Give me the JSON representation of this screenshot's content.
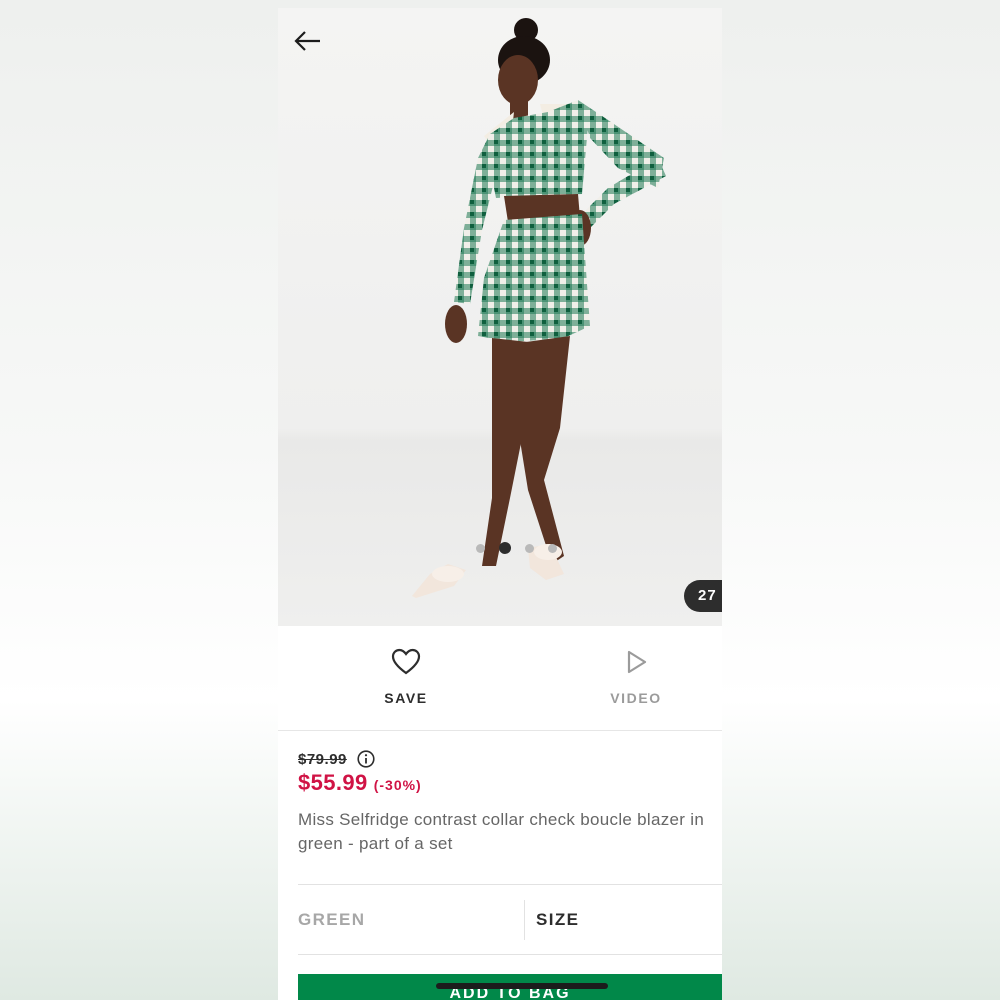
{
  "hero": {
    "image_count_badge": "27",
    "carousel": {
      "total": 4,
      "active_index": 1
    }
  },
  "actions": {
    "save_label": "SAVE",
    "video_label": "VIDEO"
  },
  "price": {
    "old": "$79.99",
    "now": "$55.99",
    "discount": "(-30%)"
  },
  "product": {
    "title_line1": "Miss Selfridge contrast collar check boucle blazer in",
    "title_line2": "green - part of a set"
  },
  "selectors": {
    "colour": "GREEN",
    "size": "SIZE"
  },
  "add_to_bag": "ADD TO BAG",
  "colors": {
    "sale_red": "#d01345",
    "bag_green": "#018849",
    "dark": "#2d2d2d",
    "muted": "#9b9b9b"
  }
}
